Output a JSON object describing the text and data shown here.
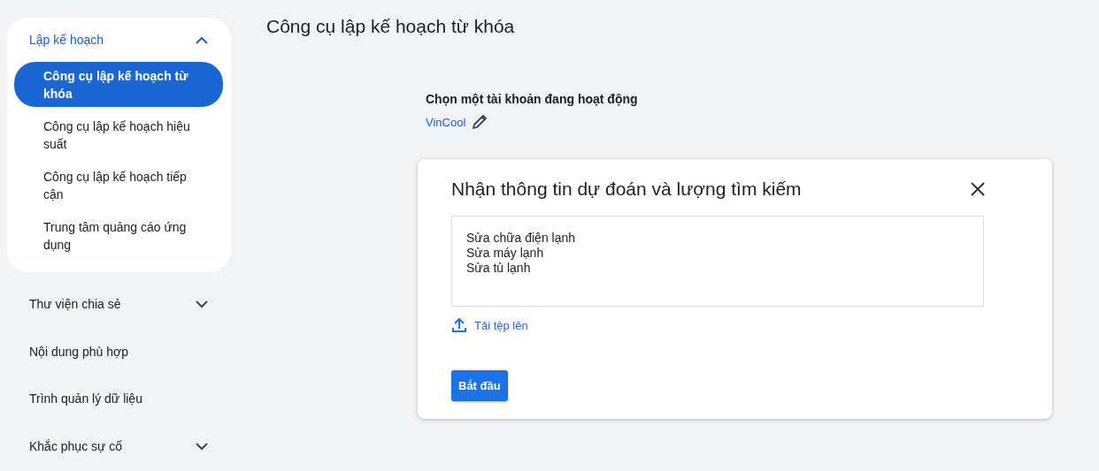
{
  "sidebar": {
    "items": [
      {
        "kind": "group",
        "label": "Lập kế hoạch",
        "expanded": true,
        "children": [
          {
            "label": "Công cụ lập kế hoạch từ khóa",
            "selected": true
          },
          {
            "label": "Công cụ lập kế hoạch hiệu suất",
            "selected": false
          },
          {
            "label": "Công cụ lập kế hoạch tiếp cận",
            "selected": false
          },
          {
            "label": "Trung tâm quảng cáo ứng dụng",
            "selected": false
          }
        ]
      },
      {
        "kind": "group",
        "label": "Thư viện chia sẻ",
        "expanded": false
      },
      {
        "kind": "link",
        "label": "Nội dung phù hợp"
      },
      {
        "kind": "link",
        "label": "Trình quản lý dữ liệu"
      },
      {
        "kind": "group",
        "label": "Khắc phục sự cố",
        "expanded": false
      }
    ]
  },
  "page": {
    "title": "Công cụ lập kế hoạch từ khóa"
  },
  "account": {
    "label": "Chọn một tài khoản đang hoạt động",
    "name": "VinCool"
  },
  "dialog": {
    "title": "Nhận thông tin dự đoán và lượng tìm kiếm",
    "keywords": "Sửa chữa điện lạnh\nSửa máy lạnh\nSửa tủ lạnh",
    "upload": "Tải tệp lên",
    "start": "Bắt đầu"
  }
}
